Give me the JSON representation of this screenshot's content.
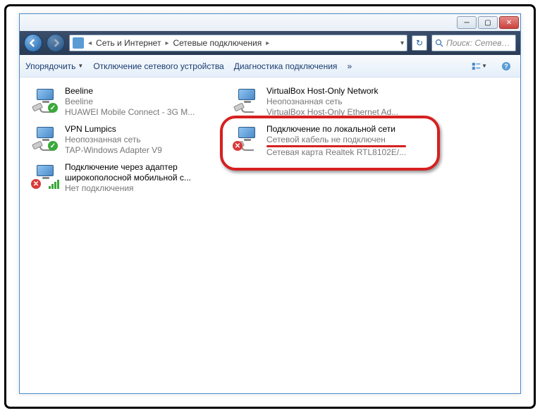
{
  "window": {
    "breadcrumb": [
      "Сеть и Интернет",
      "Сетевые подключения"
    ],
    "search_placeholder": "Поиск: Сетев…"
  },
  "toolbar": {
    "organize": "Упорядочить",
    "disable": "Отключение сетевого устройства",
    "diagnose": "Диагностика подключения",
    "more": "»"
  },
  "connections": [
    {
      "id": "beeline",
      "name": "Beeline",
      "status": "Beeline",
      "detail": "HUAWEI Mobile Connect - 3G M...",
      "badge": "ok"
    },
    {
      "id": "vpn",
      "name": "VPN Lumpics",
      "status": "Неопознанная сеть",
      "detail": "TAP-Windows Adapter V9",
      "badge": "ok"
    },
    {
      "id": "broadband",
      "name": "Подключение через адаптер широкополосной мобильной с...",
      "status": "Нет подключения",
      "detail": "",
      "badge": "x-signal"
    },
    {
      "id": "vbox",
      "name": "VirtualBox Host-Only Network",
      "status": "Неопознанная сеть",
      "detail": "VirtualBox Host-Only Ethernet Ad...",
      "badge": "none"
    },
    {
      "id": "lan",
      "name": "Подключение по локальной сети",
      "status": "Сетевой кабель не подключен",
      "detail": "Сетевая карта Realtek RTL8102E/...",
      "badge": "x"
    }
  ]
}
